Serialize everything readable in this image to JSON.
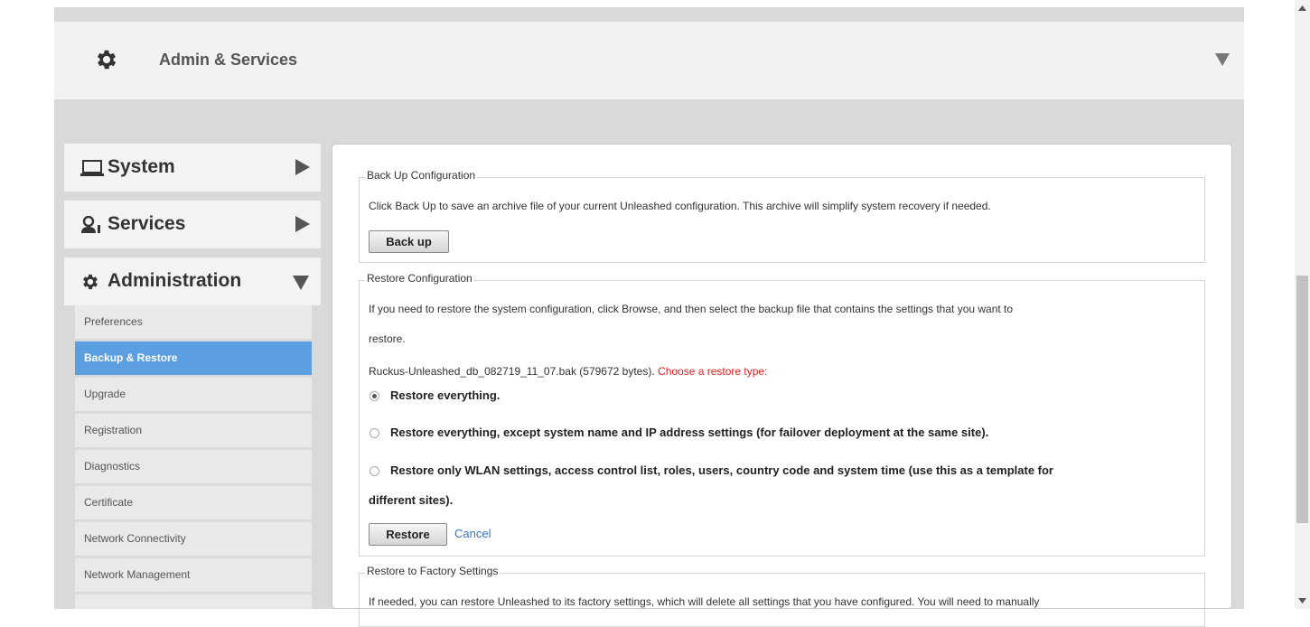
{
  "header": {
    "title": "Admin & Services",
    "icon": "gear-icon"
  },
  "sidebar": {
    "sections": [
      {
        "label": "System",
        "icon": "laptop-icon",
        "arrow": "right"
      },
      {
        "label": "Services",
        "icon": "services-icon",
        "arrow": "right"
      },
      {
        "label": "Administration",
        "icon": "gear-icon",
        "arrow": "down"
      }
    ],
    "items": [
      {
        "label": "Preferences"
      },
      {
        "label": "Backup & Restore",
        "active": true
      },
      {
        "label": "Upgrade"
      },
      {
        "label": "Registration"
      },
      {
        "label": "Diagnostics"
      },
      {
        "label": "Certificate"
      },
      {
        "label": "Network Connectivity"
      },
      {
        "label": "Network Management"
      }
    ]
  },
  "backup": {
    "legend": "Back Up Configuration",
    "description": "Click Back Up to save an archive file of your current Unleashed configuration. This archive will simplify system recovery if needed.",
    "button": "Back up"
  },
  "restore": {
    "legend": "Restore Configuration",
    "description_line1": "If you need to restore the system configuration, click Browse, and then select the backup file that contains the settings that you want to",
    "description_line2": "restore.",
    "file_info": "Ruckus-Unleashed_db_082719_11_07.bak (579672 bytes).",
    "choose_prompt": "Choose a restore type:",
    "options": [
      {
        "label": "Restore everything.",
        "checked": true
      },
      {
        "label": "Restore everything, except system name and IP address settings (for failover deployment at the same site).",
        "checked": false
      },
      {
        "label_line1": "Restore only WLAN settings, access control list, roles, users, country code and system time (use this as a template for",
        "label_line2": "different sites).",
        "checked": false
      }
    ],
    "restore_button": "Restore",
    "cancel_link": "Cancel"
  },
  "factory": {
    "legend": "Restore to Factory Settings",
    "description": "If needed, you can restore Unleashed to its factory settings, which will delete all settings that you have configured. You will need to manually"
  },
  "colors": {
    "active_item": "#5b9fe0",
    "warning_text": "#e02020",
    "link": "#3a78c3"
  }
}
